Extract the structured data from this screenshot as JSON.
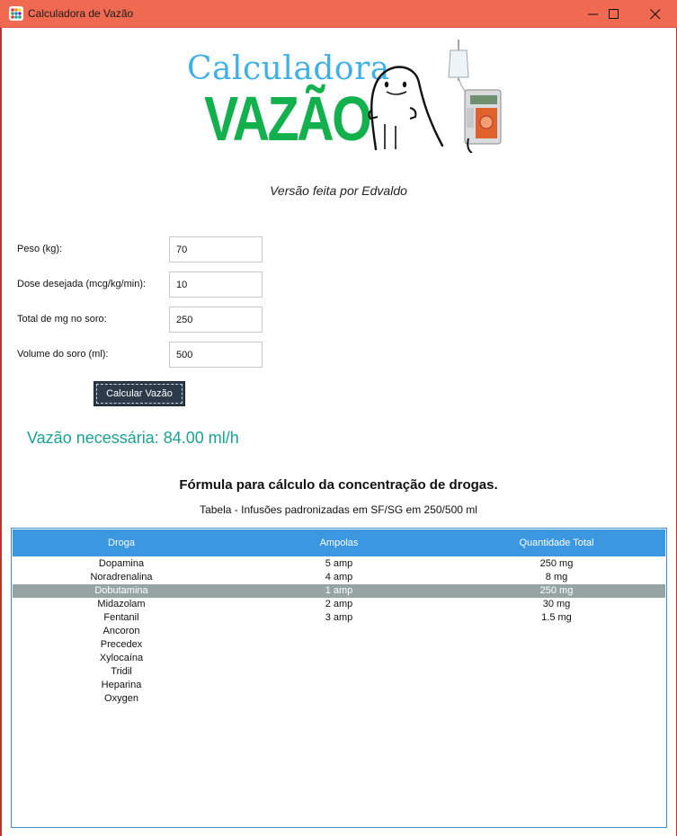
{
  "window": {
    "title": "Calculadora de Vazão",
    "title_bar_color": "#f06a52"
  },
  "logo": {
    "line1": "Calculadora",
    "line2": "VAZÃO",
    "line1_color": "#3fb1e6",
    "line2_color": "#13b04e"
  },
  "credit": "Versão feita por Edvaldo",
  "form": {
    "fields": [
      {
        "label": "Peso (kg):",
        "value": "70"
      },
      {
        "label": "Dose desejada (mcg/kg/min):",
        "value": "10"
      },
      {
        "label": "Total de mg no soro:",
        "value": "250"
      },
      {
        "label": "Volume do soro (ml):",
        "value": "500"
      }
    ],
    "button_label": "Calcular Vazão"
  },
  "result": "Vazão necessária: 84.00 ml/h",
  "formula_title": "Fórmula para cálculo da concentração de drogas.",
  "table_caption": "Tabela - Infusões padronizadas em SF/SG em 250/500 ml",
  "table": {
    "headers": [
      "Droga",
      "Ampolas",
      "Quantidade Total"
    ],
    "selected_row": 2,
    "rows": [
      [
        "Dopamina",
        "5 amp",
        "250 mg"
      ],
      [
        "Noradrenalina",
        "4 amp",
        "8 mg"
      ],
      [
        "Dobutamina",
        "1 amp",
        "250 mg"
      ],
      [
        "Midazolam",
        "2 amp",
        "30 mg"
      ],
      [
        "Fentanil",
        "3 amp",
        "1.5 mg"
      ],
      [
        "Ancoron",
        "",
        ""
      ],
      [
        "Precedex",
        "",
        ""
      ],
      [
        "Xylocaína",
        "",
        ""
      ],
      [
        "Tridil",
        "",
        ""
      ],
      [
        "Heparina",
        "",
        ""
      ],
      [
        "Oxygen",
        "",
        ""
      ]
    ],
    "header_color": "#3a97e0",
    "selected_color": "#96a4a4"
  },
  "colors": {
    "result_text": "#1aa394",
    "button_bg": "#2d3a4a"
  },
  "icons": {
    "app": "app-grid-icon",
    "minimize": "minimize-icon",
    "maximize": "maximize-icon",
    "close": "close-icon"
  }
}
